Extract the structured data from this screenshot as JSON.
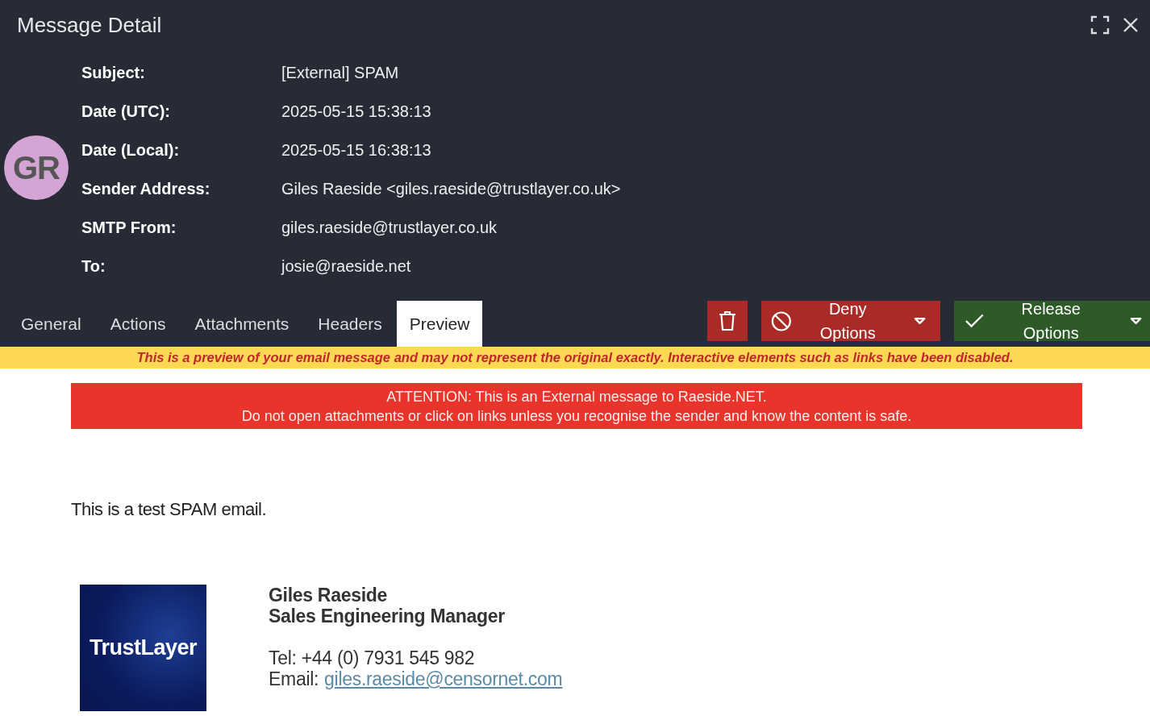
{
  "window": {
    "title": "Message Detail"
  },
  "avatar": {
    "initials": "GR",
    "color": "#d4a5d4"
  },
  "fields": [
    {
      "label": "Subject:",
      "value": "[External] SPAM"
    },
    {
      "label": "Date (UTC):",
      "value": "2025-05-15 15:38:13"
    },
    {
      "label": "Date (Local):",
      "value": "2025-05-15 16:38:13"
    },
    {
      "label": "Sender Address:",
      "value": "Giles Raeside <giles.raeside@trustlayer.co.uk>"
    },
    {
      "label": "SMTP From:",
      "value": "giles.raeside@trustlayer.co.uk"
    },
    {
      "label": "To:",
      "value": "josie@raeside.net"
    }
  ],
  "tabs": [
    {
      "label": "General",
      "selected": false
    },
    {
      "label": "Actions",
      "selected": false
    },
    {
      "label": "Attachments",
      "selected": false
    },
    {
      "label": "Headers",
      "selected": false
    },
    {
      "label": "Preview",
      "selected": true
    }
  ],
  "buttons": [
    {
      "kind": "delete"
    },
    {
      "kind": "deny",
      "label": "Deny Options"
    },
    {
      "kind": "release",
      "label": "Release Options"
    }
  ],
  "notice": "This is a preview of your email message and may not represent the original exactly. Interactive elements such as links have been disabled.",
  "preview": {
    "banner": [
      "ATTENTION: This is an External message to Raeside.NET.",
      "Do not open attachments or click on links unless you recognise the sender and know the content is safe."
    ],
    "body": "This is a test SPAM email.",
    "signature": {
      "logo_text": "TrustLayer",
      "name": "Giles Raeside",
      "role": "Sales Engineering Manager",
      "tel": "Tel: +44 (0) 7931 545 982",
      "email_label": "Email:",
      "email": "giles.raeside@censornet.com"
    }
  }
}
